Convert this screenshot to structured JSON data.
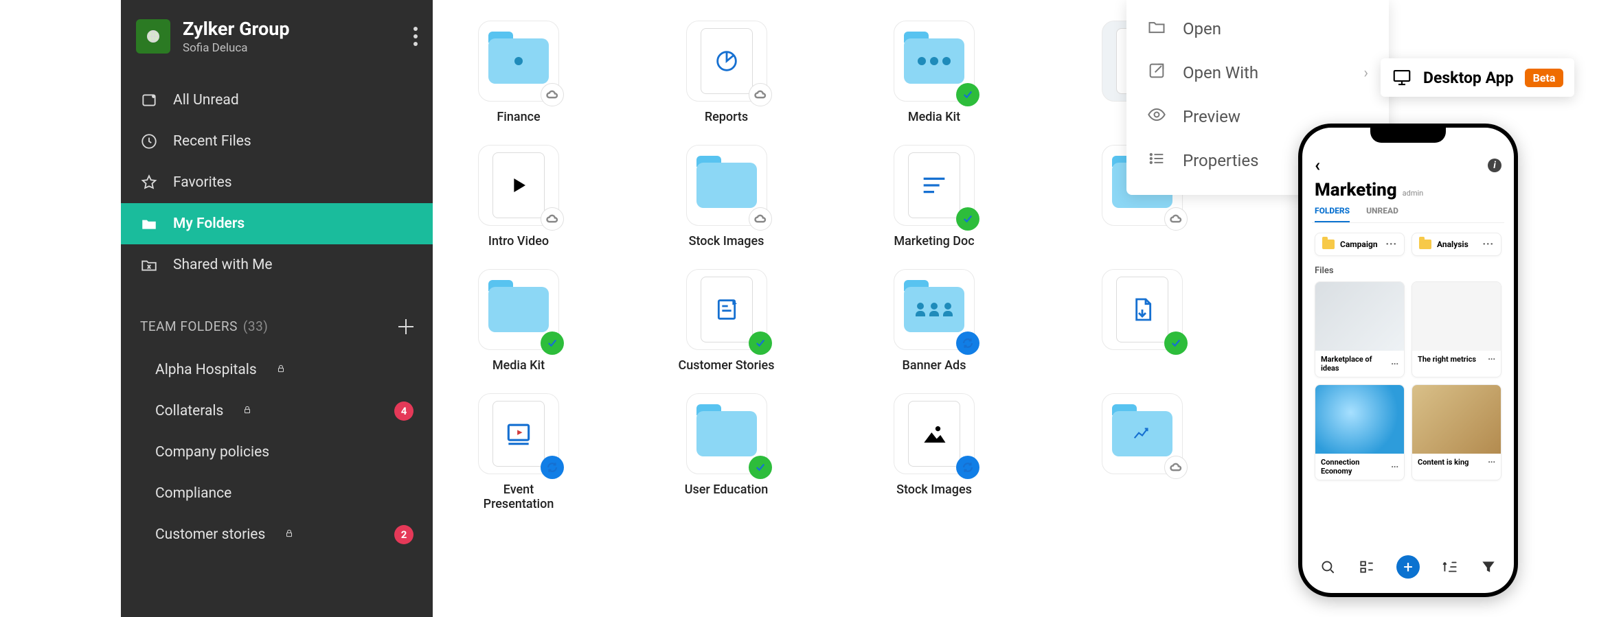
{
  "sidebar": {
    "org_name": "Zylker Group",
    "user_name": "Sofia Deluca",
    "nav": [
      {
        "label": "All Unread"
      },
      {
        "label": "Recent Files"
      },
      {
        "label": "Favorites"
      },
      {
        "label": "My Folders"
      },
      {
        "label": "Shared with Me"
      }
    ],
    "team_header": "TEAM FOLDERS",
    "team_count": "(33)",
    "team_items": [
      {
        "label": "Alpha Hospitals",
        "locked": true,
        "badge": ""
      },
      {
        "label": "Collaterals",
        "locked": true,
        "badge": "4"
      },
      {
        "label": "Company policies",
        "locked": false,
        "badge": ""
      },
      {
        "label": "Compliance",
        "locked": false,
        "badge": ""
      },
      {
        "label": "Customer stories",
        "locked": true,
        "badge": "2"
      }
    ]
  },
  "grid": [
    {
      "label": "Finance",
      "kind": "folder",
      "deco": "dot",
      "status": "cloud"
    },
    {
      "label": "Reports",
      "kind": "doc",
      "deco": "pie",
      "status": "cloud"
    },
    {
      "label": "Media Kit",
      "kind": "folder",
      "deco": "dots3",
      "status": "green"
    },
    {
      "label": "",
      "kind": "doc",
      "deco": "image",
      "status": "",
      "selected": true
    },
    {
      "label": "Intro Video",
      "kind": "doc",
      "deco": "play",
      "status": "cloud"
    },
    {
      "label": "Stock Images",
      "kind": "folder",
      "deco": "",
      "status": "cloud"
    },
    {
      "label": "Marketing Doc",
      "kind": "doc",
      "deco": "lines",
      "status": "green"
    },
    {
      "label": "",
      "kind": "folder",
      "deco": "",
      "status": "cloud"
    },
    {
      "label": "Media Kit",
      "kind": "folder",
      "deco": "",
      "status": "green"
    },
    {
      "label": "Customer Stories",
      "kind": "doc",
      "deco": "note",
      "status": "green"
    },
    {
      "label": "Banner Ads",
      "kind": "folder",
      "deco": "people",
      "status": "blue"
    },
    {
      "label": "",
      "kind": "doc",
      "deco": "pdf",
      "status": "green"
    },
    {
      "label": "Event Presentation",
      "kind": "doc",
      "deco": "slide",
      "status": "blue"
    },
    {
      "label": "User Education",
      "kind": "folder",
      "deco": "",
      "status": "green"
    },
    {
      "label": "Stock Images",
      "kind": "doc",
      "deco": "image",
      "status": "blue"
    },
    {
      "label": "",
      "kind": "folder",
      "deco": "chart",
      "status": "cloud"
    }
  ],
  "context": {
    "items": [
      {
        "label": "Open",
        "icon": "folder"
      },
      {
        "label": "Open With",
        "icon": "external",
        "sub": true
      },
      {
        "label": "Preview",
        "icon": "eye"
      },
      {
        "label": "Properties",
        "icon": "list"
      }
    ]
  },
  "chip": {
    "label": "Desktop App",
    "badge": "Beta"
  },
  "phone": {
    "title": "Marketing",
    "subtitle": "admin",
    "tabs": [
      "FOLDERS",
      "UNREAD"
    ],
    "folders": [
      {
        "name": "Campaign"
      },
      {
        "name": "Analysis"
      }
    ],
    "files_label": "Files",
    "files": [
      {
        "name": "Marketplace of ideas",
        "img": "sketch"
      },
      {
        "name": "The right metrics",
        "img": "metrics"
      },
      {
        "name": "Connection Economy",
        "img": "globe"
      },
      {
        "name": "Content is king",
        "img": "chess"
      }
    ]
  }
}
